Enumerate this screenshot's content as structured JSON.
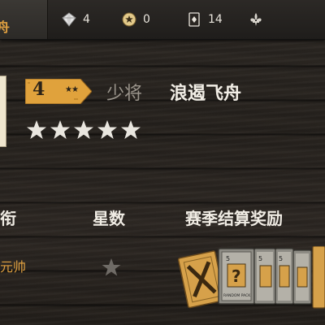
{
  "header": {
    "ship_tab_label": "舟",
    "resources": [
      {
        "icon": "diamond-icon",
        "value": "4"
      },
      {
        "icon": "coin-icon",
        "value": "0"
      },
      {
        "icon": "card-icon",
        "value": "14"
      },
      {
        "icon": "fleur-de-lis-icon",
        "value": ""
      }
    ]
  },
  "profile": {
    "rank_number": "4",
    "rank_title": "少将",
    "ship_name": "浪遏飞舟",
    "rating_stars": 5
  },
  "table": {
    "headers": [
      "衔",
      "星数",
      "赛季结算奖励"
    ],
    "rows": [
      {
        "rank": "元帅",
        "stars": 1
      }
    ]
  },
  "rewards": {
    "card_number": "5",
    "pack_label": "RANDOM PACK"
  },
  "colors": {
    "accent": "#e0a040",
    "gold": "#d99a38"
  }
}
